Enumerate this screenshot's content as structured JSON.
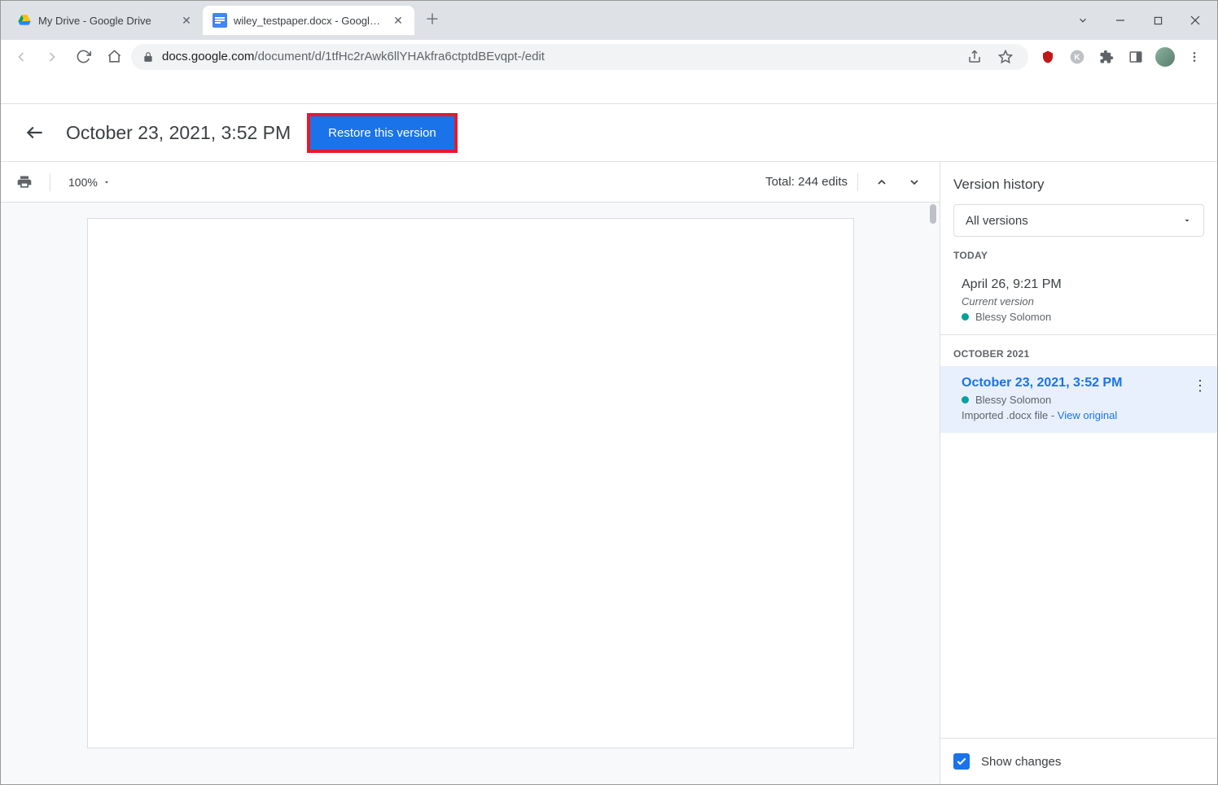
{
  "browser": {
    "tabs": [
      {
        "title": "My Drive - Google Drive",
        "icon": "drive"
      },
      {
        "title": "wiley_testpaper.docx - Google D",
        "icon": "docs"
      }
    ],
    "active_tab": 1,
    "url_host": "docs.google.com",
    "url_path": "/document/d/1tfHc2rAwk6llYHAkfra6ctptdBEvqpt-/edit"
  },
  "header": {
    "title": "October 23, 2021, 3:52 PM",
    "restore_label": "Restore this version"
  },
  "toolbar": {
    "zoom": "100%",
    "total_edits": "Total: 244 edits"
  },
  "sidebar": {
    "title": "Version history",
    "dropdown": "All versions",
    "sections": {
      "today_label": "TODAY",
      "today_item": {
        "time": "April 26, 9:21 PM",
        "subtitle": "Current version",
        "user": "Blessy Solomon"
      },
      "october_label": "OCTOBER 2021",
      "october_item": {
        "time": "October 23, 2021, 3:52 PM",
        "user": "Blessy Solomon",
        "note_prefix": "Imported .docx file - ",
        "note_link": "View original"
      }
    },
    "show_changes": "Show changes"
  }
}
